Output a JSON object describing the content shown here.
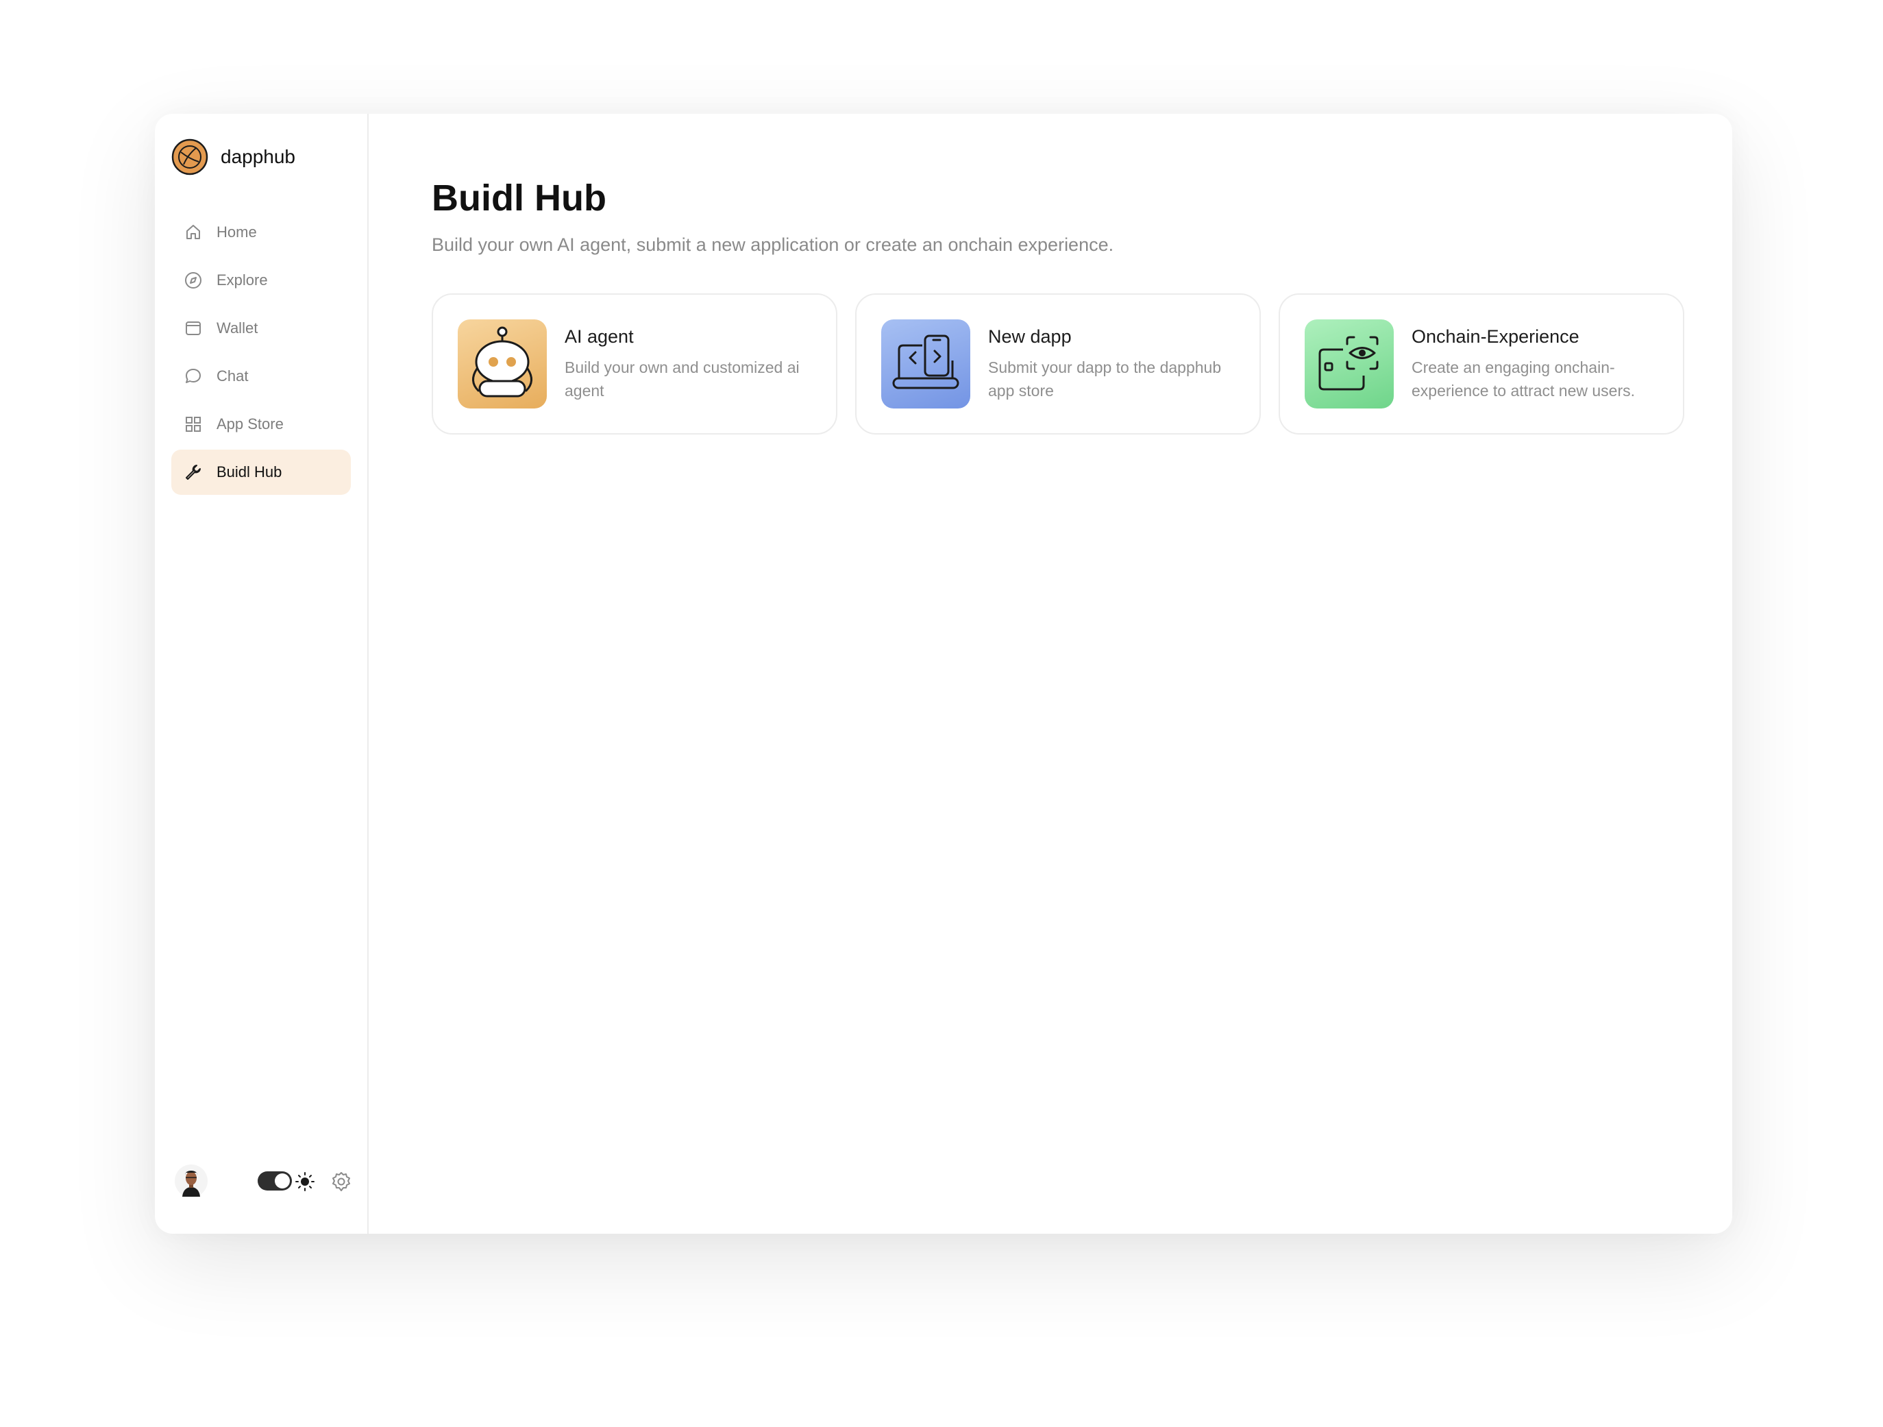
{
  "app": {
    "brand_name": "dapphub",
    "accent_color": "#fbeee0",
    "brand_color": "#e39a4f"
  },
  "sidebar": {
    "items": [
      {
        "label": "Home",
        "icon": "home-icon"
      },
      {
        "label": "Explore",
        "icon": "compass-icon"
      },
      {
        "label": "Wallet",
        "icon": "wallet-icon"
      },
      {
        "label": "Chat",
        "icon": "chat-icon"
      },
      {
        "label": "App Store",
        "icon": "grid-icon"
      },
      {
        "label": "Buidl Hub",
        "icon": "wrench-icon",
        "active": true
      }
    ],
    "footer": {
      "avatar": "avatar",
      "theme_toggle": "on",
      "sun_icon": "sun-icon",
      "settings_icon": "gear-icon"
    }
  },
  "main": {
    "title": "Buidl Hub",
    "subtitle": "Build your own AI agent, submit a new application or create an onchain experience.",
    "cards": [
      {
        "title": "AI agent",
        "description": "Build your own and customized ai agent",
        "icon": "robot-icon",
        "color": "#eab66b"
      },
      {
        "title": "New dapp",
        "description": "Submit your dapp to the dapphub app store",
        "icon": "code-device-icon",
        "color": "#88a6ea"
      },
      {
        "title": "Onchain-Experience",
        "description": "Create an engaging onchain-experience to attract new users.",
        "icon": "eye-scan-icon",
        "color": "#8ee2a2"
      }
    ]
  }
}
